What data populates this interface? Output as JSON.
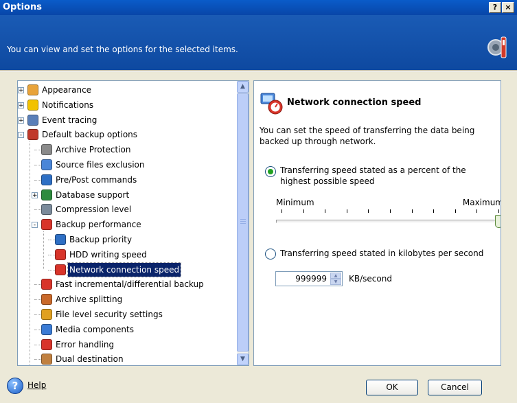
{
  "window": {
    "title": "Options",
    "help_btn": "?",
    "close_btn": "×"
  },
  "banner": {
    "description": "You can view and set the options for the selected items.",
    "icon": "tools-icon"
  },
  "tree": {
    "items": [
      {
        "label": "Appearance",
        "icon": "appearance-icon"
      },
      {
        "label": "Notifications",
        "icon": "notifications-icon"
      },
      {
        "label": "Event tracing",
        "icon": "event-tracing-icon"
      },
      {
        "label": "Default backup options",
        "icon": "backup-options-icon"
      },
      {
        "label": "Archive Protection",
        "icon": "lock-icon"
      },
      {
        "label": "Source files exclusion",
        "icon": "filter-icon"
      },
      {
        "label": "Pre/Post commands",
        "icon": "commands-icon"
      },
      {
        "label": "Database support",
        "icon": "shield-icon"
      },
      {
        "label": "Compression level",
        "icon": "compression-icon"
      },
      {
        "label": "Backup performance",
        "icon": "gauge-icon"
      },
      {
        "label": "Backup priority",
        "icon": "priority-icon"
      },
      {
        "label": "HDD writing speed",
        "icon": "gauge-icon"
      },
      {
        "label": "Network connection speed",
        "icon": "gauge-icon",
        "selected": true
      },
      {
        "label": "Fast incremental/differential backup",
        "icon": "incremental-icon"
      },
      {
        "label": "Archive splitting",
        "icon": "splitting-icon"
      },
      {
        "label": "File level security settings",
        "icon": "security-icon"
      },
      {
        "label": "Media components",
        "icon": "media-icon"
      },
      {
        "label": "Error handling",
        "icon": "error-icon"
      },
      {
        "label": "Dual destination",
        "icon": "dual-destination-icon"
      }
    ]
  },
  "panel": {
    "title": "Network connection speed",
    "icon": "network-speed-icon",
    "description": "You can set the speed of transferring the data being backed up through network.",
    "option_percent": "Transferring speed stated as a percent of the highest possible speed",
    "option_percent_selected": true,
    "slider": {
      "min_label": "Minimum",
      "max_label": "Maximum",
      "value_percent": 100
    },
    "option_kb": "Transferring speed stated in kilobytes per second",
    "kb_value": "999999",
    "kb_unit": "KB/second"
  },
  "footer": {
    "help_label": "Help",
    "ok_label": "OK",
    "cancel_label": "Cancel"
  },
  "colors": {
    "title_bar": "#0A5CC9",
    "banner": "#1A5BB5",
    "selection": "#0A246A",
    "radio_on": "#21A121"
  }
}
